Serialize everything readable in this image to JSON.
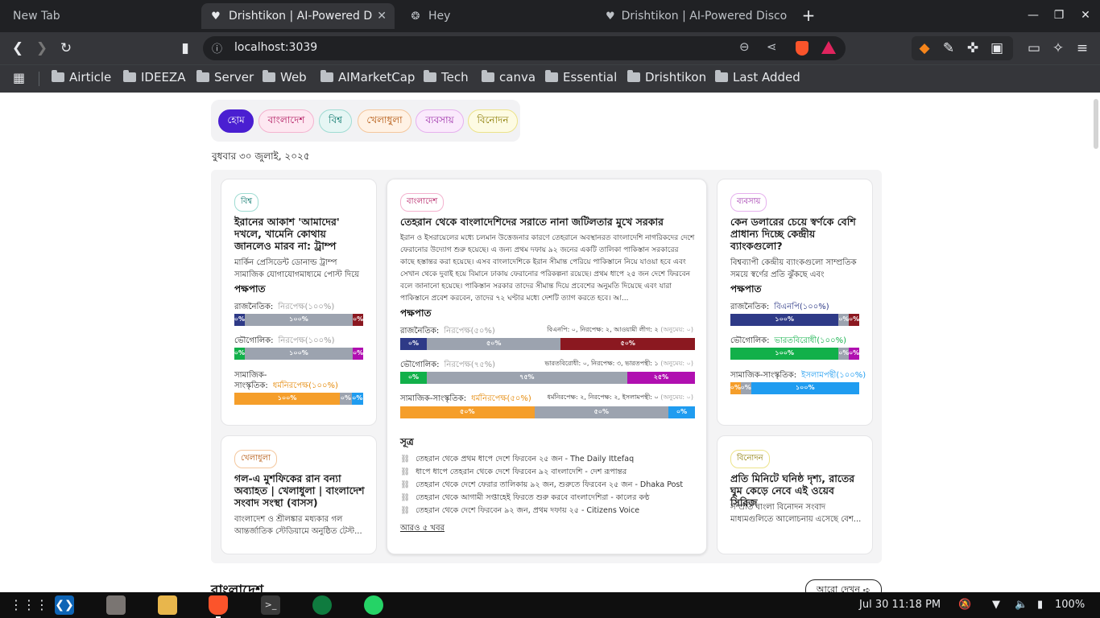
{
  "browser": {
    "tabs": [
      {
        "title": "New Tab"
      },
      {
        "title": "Drishtikon | AI-Powered D"
      },
      {
        "title": "Hey"
      },
      {
        "title": "Drishtikon | AI-Powered Disco"
      }
    ],
    "url": "localhost:3039",
    "bookmarks": [
      "Airticle",
      "IDEEZA",
      "Server",
      "Web",
      "AIMarketCap",
      "Tech",
      "canva",
      "Essential",
      "Drishtikon",
      "Last Added"
    ]
  },
  "nav": {
    "items": [
      {
        "label": "হোম",
        "bg": "#4a1fd1",
        "fg": "#ffffff",
        "border": "#4a1fd1"
      },
      {
        "label": "বাংলাদেশ",
        "bg": "#fde8f1",
        "fg": "#b0145c",
        "border": "#f4b3cf"
      },
      {
        "label": "বিশ্ব",
        "bg": "#e6f6f4",
        "fg": "#0f7a6f",
        "border": "#9fdcd3"
      },
      {
        "label": "খেলাধুলা",
        "bg": "#fff2e5",
        "fg": "#b3550c",
        "border": "#f4c79d"
      },
      {
        "label": "ব্যবসায়",
        "bg": "#faeafc",
        "fg": "#9b2ca8",
        "border": "#e6b1ee"
      },
      {
        "label": "বিনোদন",
        "bg": "#fdfbe3",
        "fg": "#8a7a00",
        "border": "#ece38a"
      }
    ]
  },
  "date_text": "বুধবার ৩০ জুলাই, ২০২৫",
  "bias_heading": "পক্ষপাত",
  "colors": {
    "navy": "#2e3a87",
    "gray": "#9ca3af",
    "maroon": "#8b1820",
    "green": "#12b04a",
    "magenta": "#b00fb0",
    "orange": "#f59e2a",
    "blue": "#1f9cf0"
  },
  "cards": {
    "world": {
      "badge": "বিশ্ব",
      "title": "ইরানের আকাশ 'আমাদের' দখলে, খামেনি কোথায় জানলেও মারব না: ট্রাম্প",
      "summary": "মার্কিন প্রেসিডেন্ট ডোনাল্ড ট্রাম্প সামাজিক যোগাযোগমাধ্যমে পোস্ট দিয়ে দাবি...",
      "rows": [
        {
          "label": "রাজনৈতিক:",
          "value": "নিরপেক্ষ(১০০%)",
          "segs": [
            "০%",
            "১০০%",
            "০%"
          ]
        },
        {
          "label": "ভৌগোলিক:",
          "value": "নিরপেক্ষ(১০০%)",
          "segs": [
            "০%",
            "১০০%",
            "০%"
          ]
        },
        {
          "label": "সামাজিক-সাংস্কৃতিক:",
          "label1": "সামাজিক-",
          "label2": "সাংস্কৃতিক:",
          "value": "ধর্মনিরপেক্ষ(১০০%)",
          "segs": [
            "১০০%",
            "০%",
            "০%"
          ]
        }
      ]
    },
    "bangladesh": {
      "badge": "বাংলাদেশ",
      "title": "তেহরান থেকে বাংলাদেশিদের সরাতে নানা জটিলতার মুখে সরকার",
      "summary": "ইরান ও ইসরায়েলের মধ্যে চলমান উত্তেজনার কারণে তেহরানে অবস্থানরত বাংলাদেশি নাগরিকদের দেশে ফেরানোর উদ্যোগ শুরু হয়েছে। এ জন্য প্রথম দফায় ৯২ জনের একটি তালিকা পাকিস্তান সরকারের কাছে হস্তান্তর করা হয়েছে। এসব বাংলাদেশিকে ইরান সীমান্ত পেরিয়ে পাকিস্তানে নিয়ে যাওয়া হবে এবং সেখান থেকে দুবাই হয়ে বিমানে ঢাকায় ফেরানোর পরিকল্পনা রয়েছে। প্রথম ধাপে ২৫ জন দেশে ফিরবেন বলে জানানো হয়েছে। পাকিস্তান সরকার তাদের সীমান্ত দিয়ে প্রবেশের অনুমতি দিয়েছে এবং যারা পাকিস্তানে প্রবেশ করবেন, তাদের ৭২ ঘণ্টার মধ্যে দেশটি ত্যাগ করতে হবে। আ...",
      "rows": [
        {
          "label": "রাজনৈতিক:",
          "value": "নিরপেক্ষ(৫০%)",
          "note": "বিএনপি: ০, নিরপেক্ষ: ২, আওয়ামী লীগ: ২",
          "note_mean": "(অনুমেয়: ০)",
          "segs": [
            "০%",
            "৫০%",
            "৫০%"
          ]
        },
        {
          "label": "ভৌগোলিক:",
          "value": "নিরপেক্ষ(৭৫%)",
          "note": "ভারতবিরোধী: ০, নিরপেক্ষ: ৩, ভারতপন্থী: ১",
          "note_mean": "(অনুমেয়: ০)",
          "segs": [
            "০%",
            "৭৫%",
            "২৫%"
          ]
        },
        {
          "label": "সামাজিক-সাংস্কৃতিক:",
          "value": "ধর্মনিরপেক্ষ(৫০%)",
          "note": "ধর্মনিরপেক্ষ: ২, নিরপেক্ষ: ২, ইসলামপন্থী: ০",
          "note_mean": "(অনুমেয়: ০)",
          "segs": [
            "৫০%",
            "৫০%",
            "০%"
          ]
        }
      ],
      "sources_heading": "সূত্র",
      "sources": [
        "তেহরান থেকে প্রথম ধাপে দেশে ফিরবেন ২৫ জন - The Daily Ittefaq",
        "ধাপে ধাপে তেহরান থেকে দেশে ফিরবেন ৯২ বাংলাদেশি - দেশ রূপান্তর",
        "তেহরান থেকে দেশে ফেরার তালিকায় ৯২ জন, শুরুতে ফিরবেন ২৫ জন - Dhaka Post",
        "তেহরান থেকে আগামী সপ্তাহেই ফিরতে শুরু করবে বাংলাদেশিরা - কালের কণ্ঠ",
        "তেহরান থেকে দেশে ফিরবেন ৯২ জন, প্রথম দফায় ২৫ - Citizens Voice"
      ],
      "more_link": "আরও ৫ খবর"
    },
    "business": {
      "badge": "ব্যবসায়",
      "title": "কেন ডলারের চেয়ে স্বর্ণকে বেশি প্রাধান্য দিচ্ছে কেন্দ্রীয় ব্যাংকগুলো?",
      "summary": "বিশ্বব্যাপী কেন্দ্রীয় ব্যাংকগুলো সাম্প্রতিক সময়ে স্বর্ণের প্রতি ঝুঁকছে এবং উল্লেখযো...",
      "rows": [
        {
          "label": "রাজনৈতিক:",
          "value": "বিএনপি(১০০%)",
          "segs": [
            "১০০%",
            "০%",
            "০%"
          ]
        },
        {
          "label": "ভৌগোলিক:",
          "value": "ভারতবিরোধী(১০০%)",
          "segs": [
            "১০০%",
            "০%",
            "০%"
          ]
        },
        {
          "label": "সামাজিক-সাংস্কৃতিক:",
          "value": "ইসলামপন্থী(১০০%)",
          "segs": [
            "০%",
            "০%",
            "১০০%"
          ]
        }
      ]
    },
    "sports": {
      "badge": "খেলাধুলা",
      "title": "গল-এ মুশফিকের রান বন্যা অব্যাহত | খেলাধুলা | বাংলাদেশ সংবাদ সংস্থা (বাসস)",
      "summary": "বাংলাদেশ ও শ্রীলঙ্কার মধ্যকার গল আন্তর্জাতিক স্টেডিয়ামে অনুষ্ঠিত টেস্ট..."
    },
    "entertainment": {
      "badge": "বিনোদন",
      "title": "প্রতি মিনিটে ঘনিষ্ঠ দৃশ্য, রাতের ঘুম কেড়ে নেবে এই ওয়েব সিরিজ",
      "summary": "সম্প্রতি বাংলা বিনোদন সংবাদ মাধ্যমগুলিতে আলোচনায় এসেছে বেশ..."
    }
  },
  "section": {
    "title": "বাংলাদেশ",
    "see_more": "আরো দেখুন"
  },
  "taskbar": {
    "datetime": "Jul 30  11:18 PM",
    "battery": "100%"
  }
}
